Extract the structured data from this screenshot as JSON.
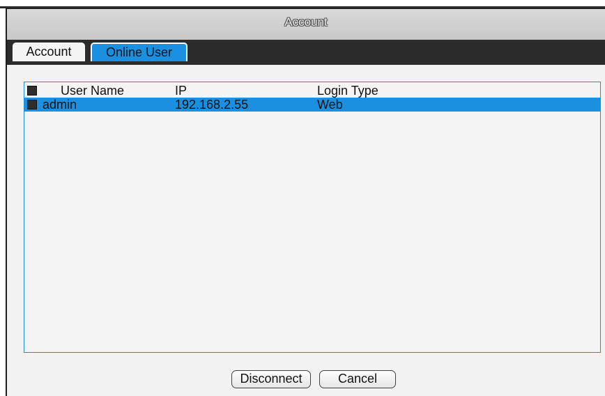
{
  "window": {
    "title": "Account"
  },
  "tabs": [
    {
      "label": "Account",
      "active": false
    },
    {
      "label": "Online User",
      "active": true
    }
  ],
  "table": {
    "headers": {
      "user_name": "User Name",
      "ip": "IP",
      "login_type": "Login Type"
    },
    "rows": [
      {
        "user_name": "admin",
        "ip": "192.168.2.55",
        "login_type": "Web",
        "selected": true
      }
    ]
  },
  "buttons": {
    "disconnect": "Disconnect",
    "cancel": "Cancel"
  },
  "colors": {
    "accent": "#1b8fe0",
    "tab_bar": "#2b2b2b",
    "panel": "#f2f2f2"
  }
}
